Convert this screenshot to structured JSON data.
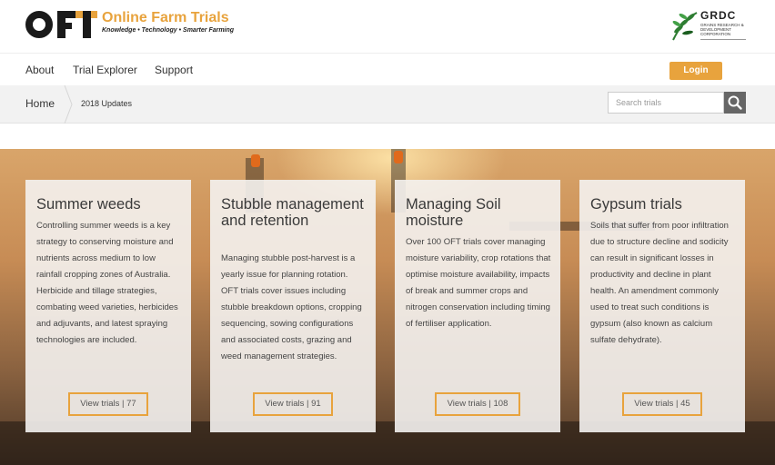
{
  "brand": {
    "logo_text": "OFT",
    "title": "Online Farm Trials",
    "tagline": "Knowledge • Technology • Smarter Farming",
    "partner_name": "GRDC",
    "partner_subtitle": "GRAINS RESEARCH & DEVELOPMENT CORPORATION",
    "accent_color": "#e8a33d"
  },
  "nav": {
    "items": [
      {
        "label": "About"
      },
      {
        "label": "Trial Explorer"
      },
      {
        "label": "Support"
      }
    ],
    "login_label": "Login"
  },
  "breadcrumb": {
    "home": "Home",
    "current": "2018 Updates"
  },
  "search": {
    "placeholder": "Search trials",
    "icon": "search-icon"
  },
  "cards": [
    {
      "title": "Summer weeds",
      "description": "Controlling summer weeds is a key strategy to conserving moisture and nutrients across medium to low rainfall cropping zones of Australia. Herbicide and tillage strategies, combating weed varieties, herbicides and adjuvants, and latest spraying technologies are included.",
      "button": "View trials | 77"
    },
    {
      "title": "Stubble management and retention",
      "description": "Managing stubble post-harvest is a yearly issue for planning rotation. OFT trials cover issues including stubble breakdown options, cropping sequencing, sowing configurations and associated costs, grazing and weed management strategies.",
      "button": "View trials | 91"
    },
    {
      "title": "Managing Soil moisture",
      "description": "Over 100 OFT trials cover managing moisture variability, crop rotations that optimise moisture availability, impacts of break and summer crops and nitrogen conservation including timing of fertiliser application.",
      "button": "View trials | 108"
    },
    {
      "title": "Gypsum trials",
      "description": "Soils that suffer from poor infiltration due to structure decline and sodicity can result in significant losses in productivity and decline in plant health. An amendment commonly used to treat such conditions is gypsum (also known as calcium sulfate dehydrate).",
      "button": "View trials | 45"
    }
  ]
}
